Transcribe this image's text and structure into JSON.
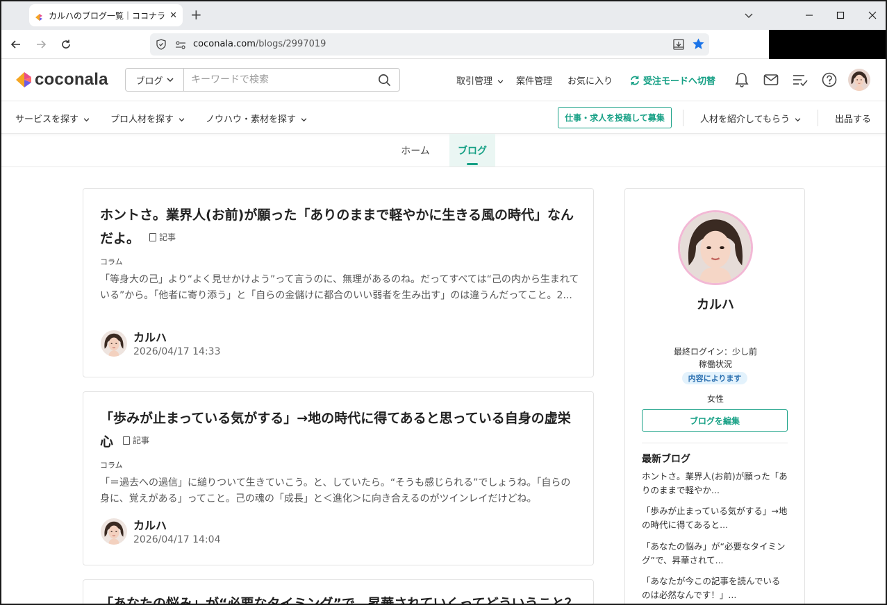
{
  "browser": {
    "tab_title": "カルハのブログ一覧｜ココナラブログ",
    "url_host": "coconala.com",
    "url_path": "/blogs/2997019"
  },
  "header": {
    "logo_text": "coconala",
    "search_category": "ブログ",
    "search_placeholder": "キーワードで検索",
    "nav": {
      "transactions": "取引管理",
      "projects": "案件管理",
      "favorites": "お気に入り",
      "switch_mode": "受注モードへ切替"
    }
  },
  "subnav": {
    "find_services": "サービスを探す",
    "find_pros": "プロ人材を探す",
    "knowhow": "ノウハウ・素材を探す",
    "post_job": "仕事・求人を投稿して募集",
    "referral": "人材を紹介してもらう",
    "sell": "出品する"
  },
  "page_tabs": {
    "home": "ホーム",
    "blog": "ブログ"
  },
  "posts": [
    {
      "title": "ホントさ。業界人(お前)が願った「ありのままで軽やかに生きる風の時代」なんだよ。",
      "badge": "記事",
      "category": "コラム",
      "excerpt": "「等身大の己」より“よく見せかけよう”って言うのに、無理があるのね。だってすべては“己の内から生まれている”から。「他者に寄り添う」と「自らの金儲けに都合のいい弱者を生み出す」のは違うんだってこと。2...",
      "author": "カルハ",
      "date": "2026/04/17 14:33"
    },
    {
      "title": "「歩みが止まっている気がする」→地の時代に得てあると思っている自身の虚栄心",
      "badge": "記事",
      "category": "コラム",
      "excerpt": "「＝過去への過信」に縋りついて生きていこう。と、していたら。“そうも感じられる”でしょうね。「自らの身に、覚えがある」ってこと。己の魂の「成長」と＜進化＞に向き合えるのがツインレイだけどね。",
      "author": "カルハ",
      "date": "2026/04/17 14:04"
    },
    {
      "title": "「あなたの悩み」が“必要なタイミング”で、昇華されていくってどういうこと？"
    }
  ],
  "profile": {
    "name": "カルハ",
    "last_login": "最終ログイン：少し前",
    "status_label": "稼働状況",
    "status_value": "内容によります",
    "gender": "女性",
    "edit_button": "ブログを編集",
    "recent_heading": "最新ブログ",
    "recent": [
      "ホントさ。業界人(お前)が願った「ありのままで軽やか...",
      "「歩みが止まっている気がする」→地の時代に得てあると...",
      "「あなたの悩み」が“必要なタイミング”で、昇華されて...",
      "「あなたが今この記事を読んでいるのは必然なんです！」..."
    ]
  },
  "colors": {
    "brand_green": "#16a085",
    "status_blue": "#2a6fb0",
    "star_blue": "#1a73e8"
  }
}
